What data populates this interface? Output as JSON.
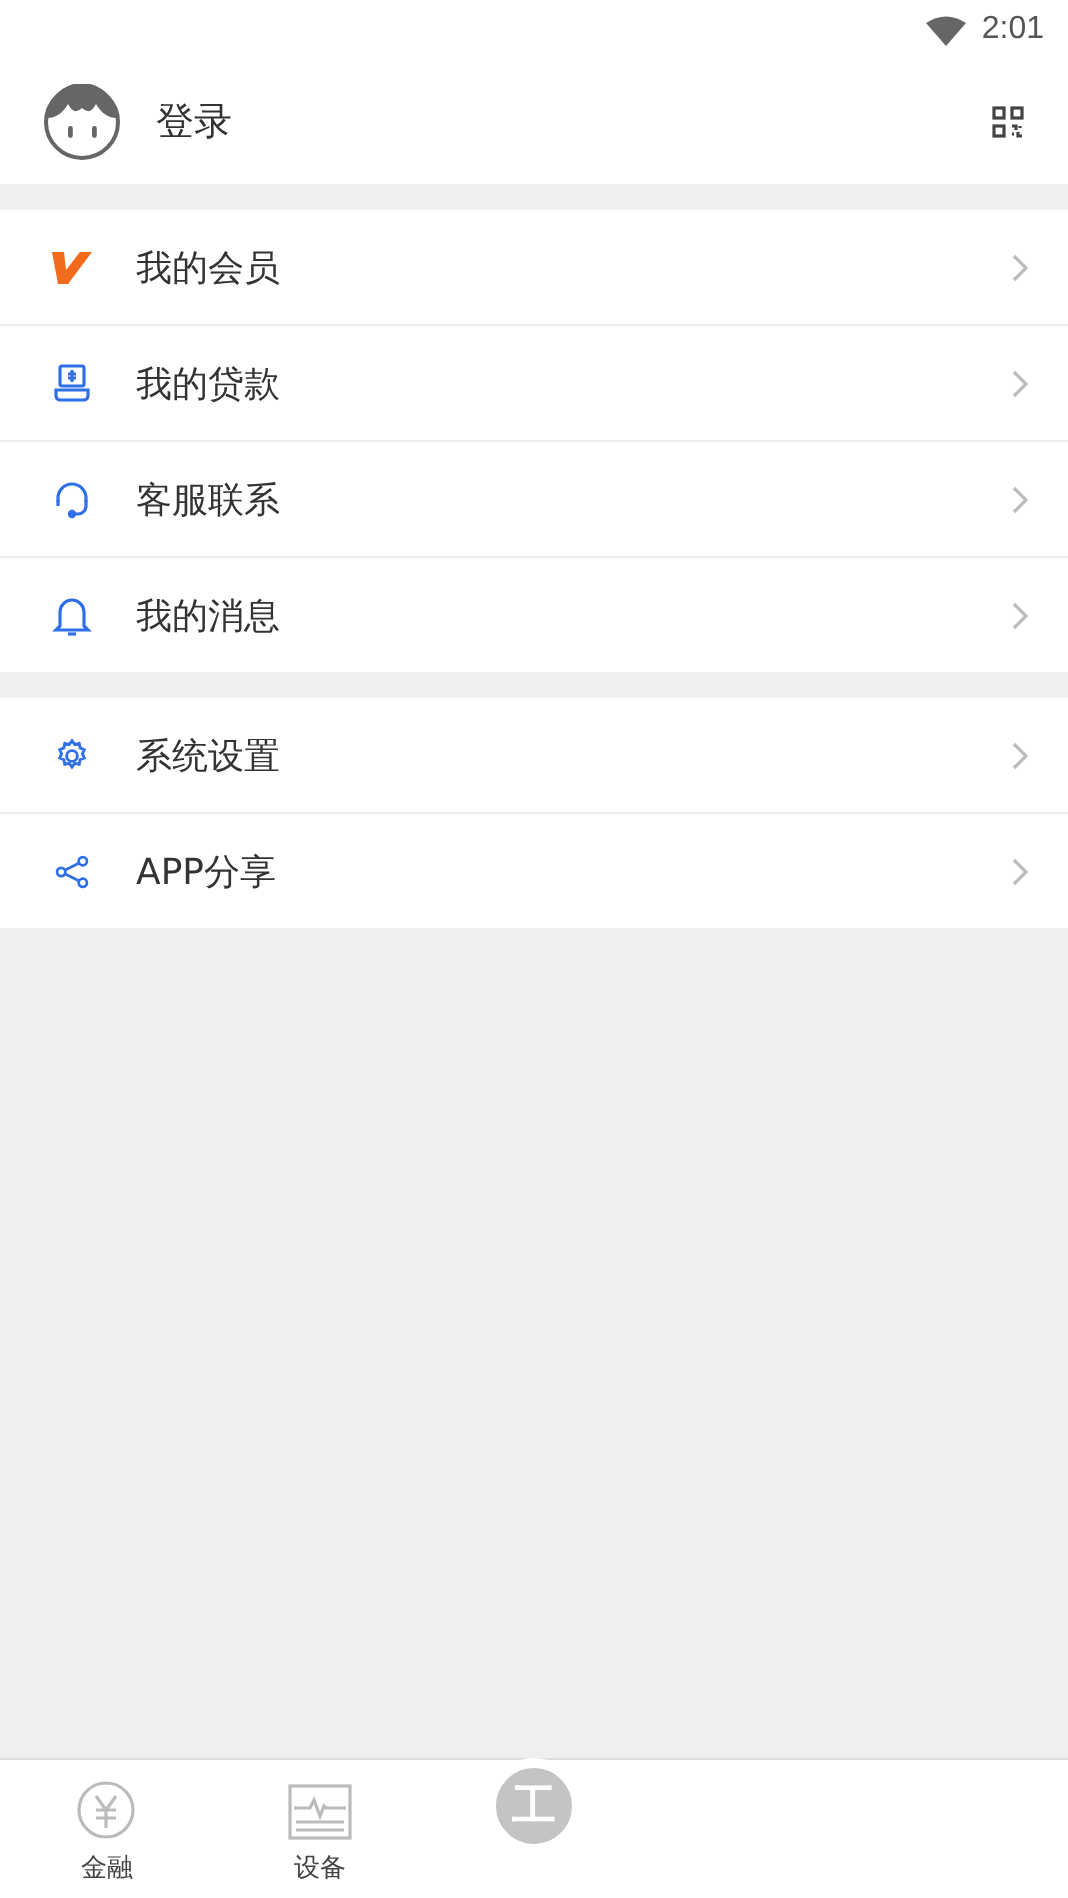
{
  "status_bar": {
    "time": "2:01"
  },
  "header": {
    "login": "登录"
  },
  "menu_groups": [
    {
      "items": [
        {
          "label": "我的会员",
          "kind": "vip"
        },
        {
          "label": "我的贷款",
          "kind": "loan"
        },
        {
          "label": "客服联系",
          "kind": "headset"
        },
        {
          "label": "我的消息",
          "kind": "bell"
        }
      ]
    },
    {
      "items": [
        {
          "label": "系统设置",
          "kind": "gear"
        },
        {
          "label": "APP分享",
          "kind": "share"
        }
      ]
    }
  ],
  "bottom_nav": {
    "tabs": [
      {
        "label": "金融",
        "kind": "yen"
      },
      {
        "label": "设备",
        "kind": "monitor"
      }
    ],
    "center_button": "工"
  }
}
